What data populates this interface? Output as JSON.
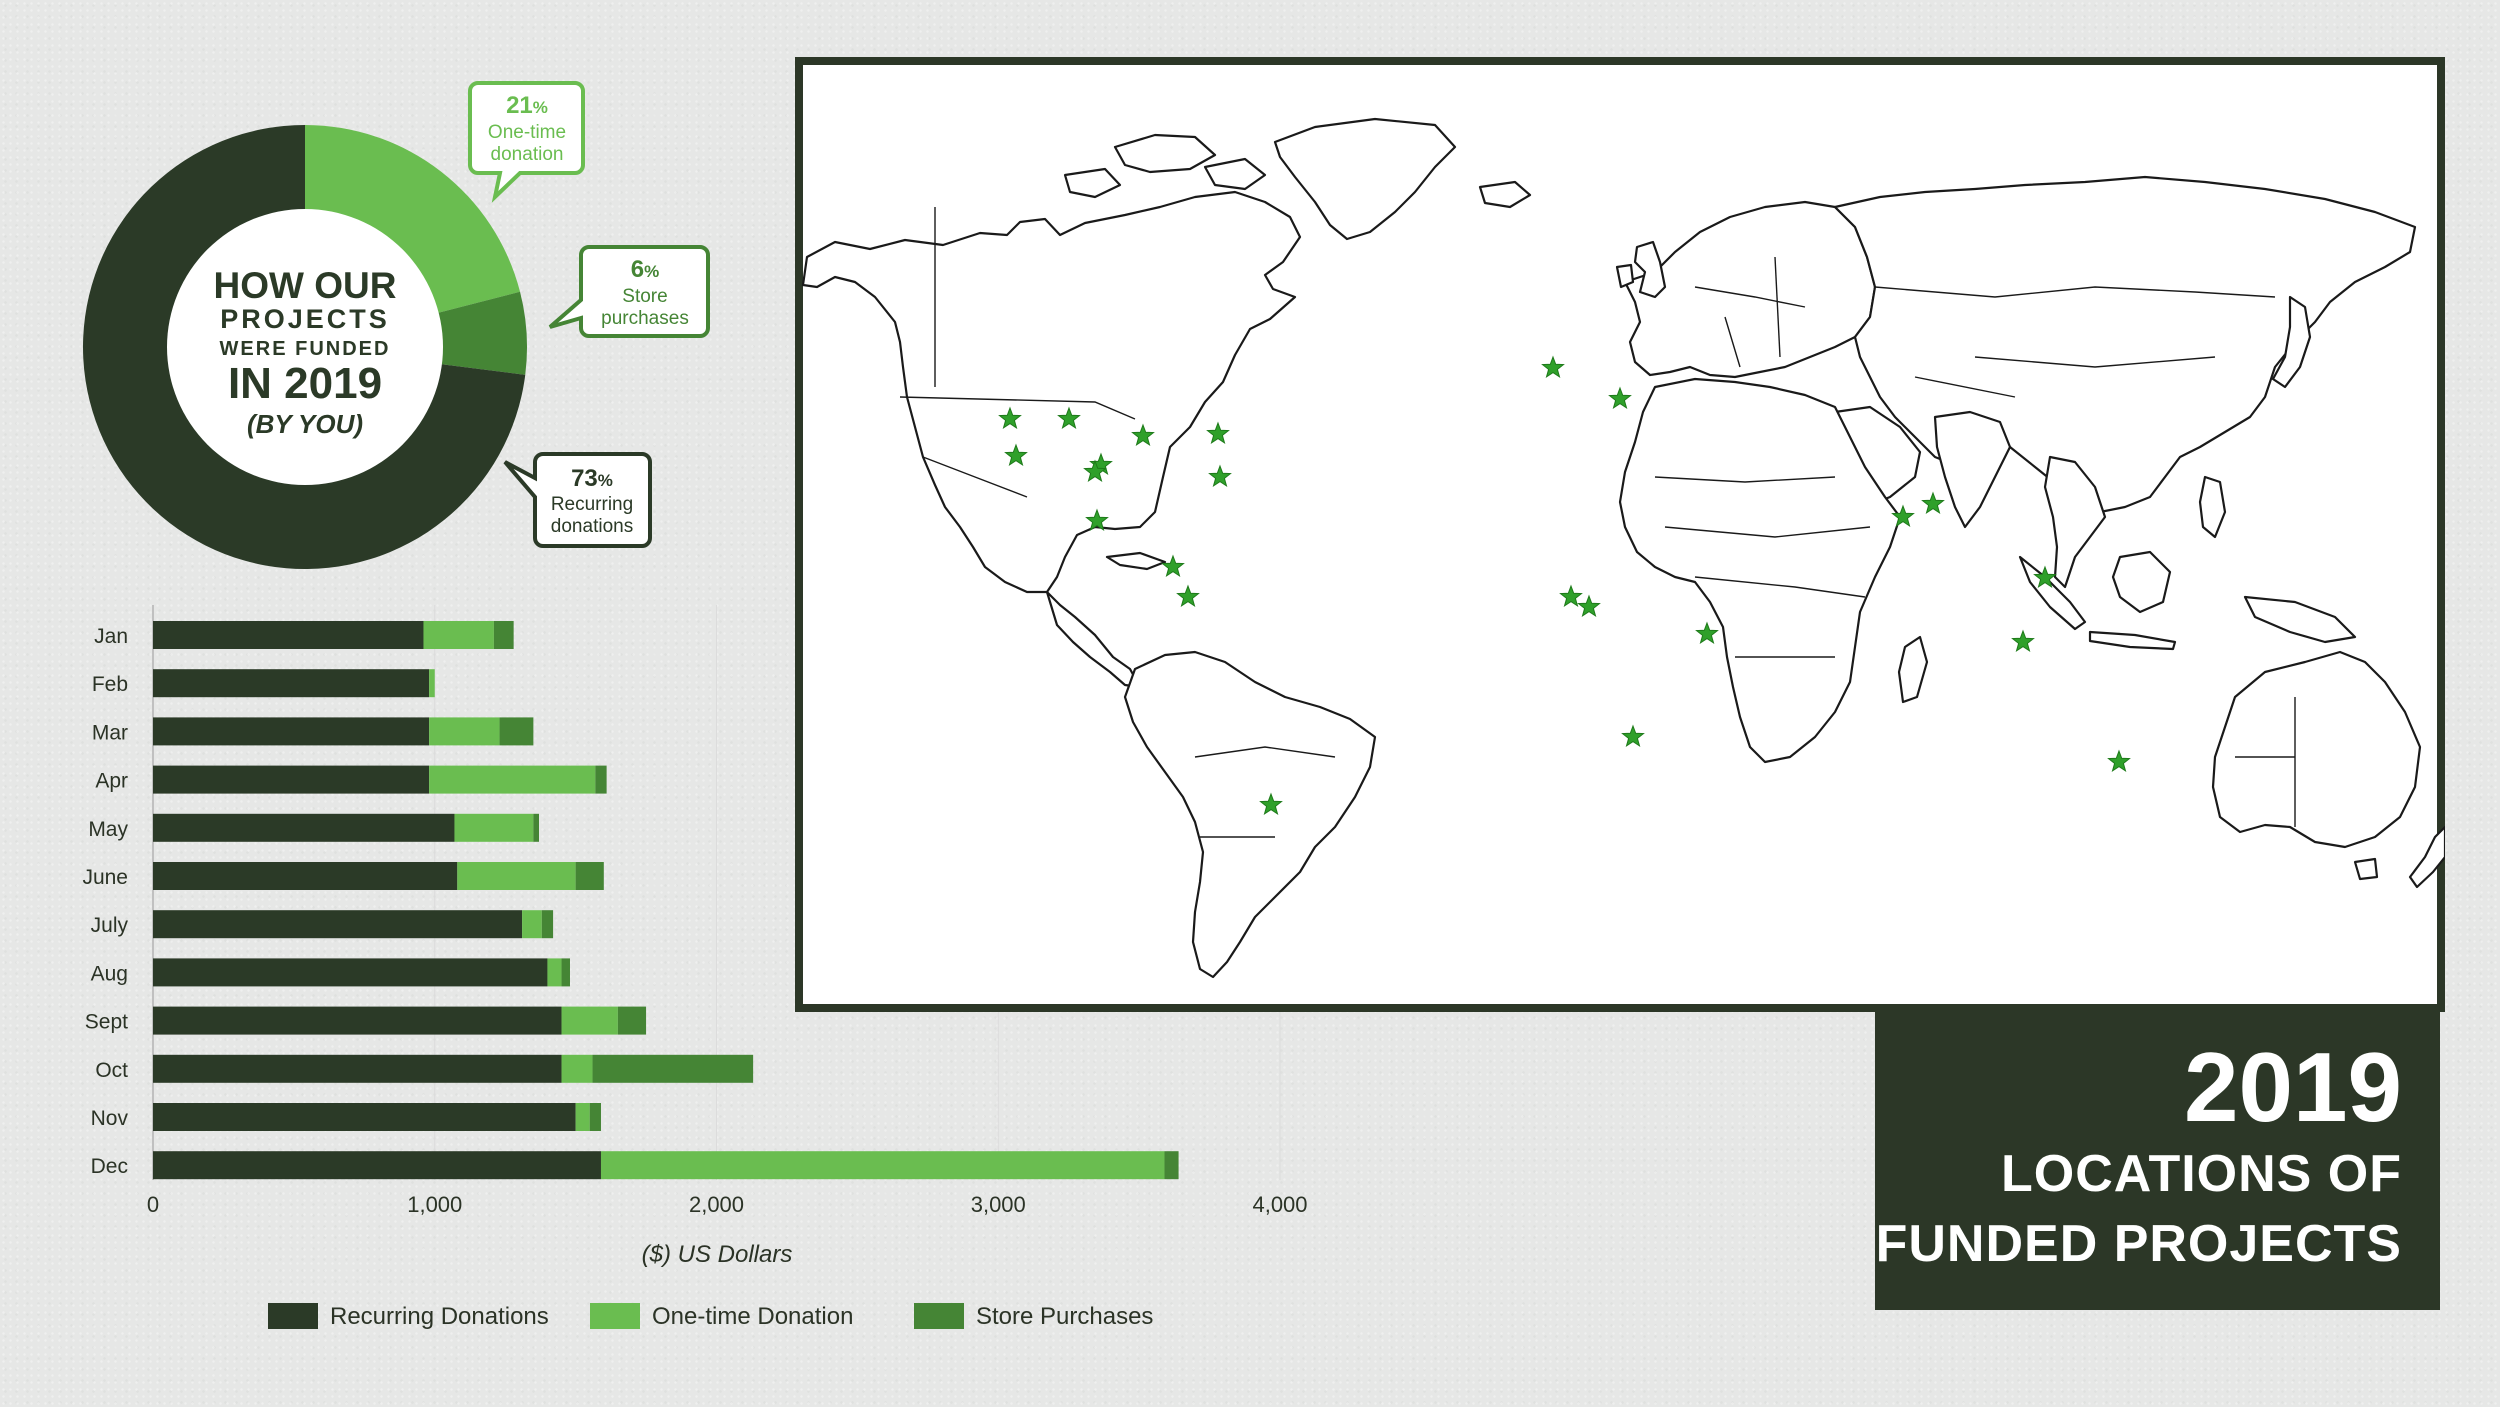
{
  "colors": {
    "dark": "#2b3a27",
    "light": "#6abd50",
    "medium": "#458535",
    "panel": "#2c3727",
    "star": "#2fa02a"
  },
  "donut": {
    "title_lines": [
      "HOW OUR",
      "PROJECTS",
      "WERE FUNDED",
      "IN 2019",
      "(BY YOU)"
    ],
    "callouts": [
      {
        "pct": "21",
        "pct_sign": "%",
        "lines": [
          "One-time",
          "donation"
        ],
        "color": "#6abd50"
      },
      {
        "pct": "6",
        "pct_sign": "%",
        "lines": [
          "Store",
          "purchases"
        ],
        "color": "#458535"
      },
      {
        "pct": "73",
        "pct_sign": "%",
        "lines": [
          "Recurring",
          "donations"
        ],
        "color": "#2b3a27"
      }
    ]
  },
  "chart_data": [
    {
      "type": "pie",
      "title": "HOW OUR PROJECTS WERE FUNDED IN 2019 (BY YOU)",
      "labels": [
        "One-time donation",
        "Store purchases",
        "Recurring donations"
      ],
      "values": [
        21,
        6,
        73
      ],
      "colors": [
        "#6abd50",
        "#458535",
        "#2b3a27"
      ]
    },
    {
      "type": "bar",
      "orientation": "horizontal",
      "stacked": true,
      "categories": [
        "Jan",
        "Feb",
        "Mar",
        "Apr",
        "May",
        "June",
        "July",
        "Aug",
        "Sept",
        "Oct",
        "Nov",
        "Dec"
      ],
      "series": [
        {
          "name": "Recurring Donations",
          "color": "#2b3a27",
          "values": [
            960,
            980,
            980,
            980,
            1070,
            1080,
            1310,
            1400,
            1450,
            1450,
            1500,
            1590
          ]
        },
        {
          "name": "One-time Donation",
          "color": "#6abd50",
          "values": [
            250,
            20,
            250,
            590,
            280,
            420,
            70,
            50,
            200,
            110,
            50,
            2000
          ]
        },
        {
          "name": "Store Purchases",
          "color": "#458535",
          "values": [
            70,
            0,
            120,
            40,
            20,
            100,
            40,
            30,
            100,
            570,
            40,
            50
          ]
        }
      ],
      "xlim": [
        0,
        4000
      ],
      "xticks": [
        0,
        1000,
        2000,
        3000,
        4000
      ],
      "xtick_labels": [
        "0",
        "1,000",
        "2,000",
        "3,000",
        "4,000"
      ],
      "xlabel": "($) US Dollars",
      "ylabel": "",
      "legend_position": "bottom"
    }
  ],
  "map": {
    "stars": [
      "Pacific Northwest USA",
      "California USA",
      "Rocky Mountains USA",
      "Colorado USA",
      "Texas USA",
      "Great Lakes USA",
      "Georgia USA",
      "Northeast USA",
      "Mexico",
      "Guatemala",
      "Costa Rica",
      "Argentina",
      "United Kingdom",
      "Central Europe",
      "Ghana",
      "Nigeria",
      "East Africa",
      "Angola",
      "Pakistan",
      "Northern India",
      "Vietnam",
      "Sumatra",
      "Australia"
    ]
  },
  "title_block": {
    "year": "2019",
    "line1": "LOCATIONS OF",
    "line2": "FUNDED PROJECTS"
  }
}
